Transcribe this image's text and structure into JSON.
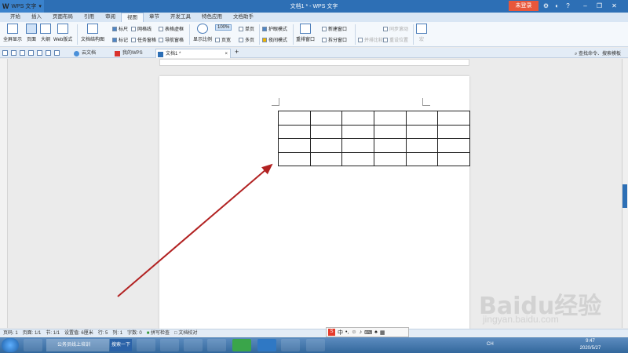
{
  "titlebar": {
    "app_name": "WPS 文字",
    "doc_title": "文档1 * - WPS 文字",
    "login": "未登录"
  },
  "tabs": [
    "开始",
    "插入",
    "页面布局",
    "引用",
    "审阅",
    "视图",
    "章节",
    "开发工具",
    "特色应用",
    "文档助手"
  ],
  "ribbon": {
    "fullscreen": "全屏显示",
    "page": "页面",
    "outline": "大纲",
    "web": "Web版式",
    "doc_structure": "文档结构图",
    "ruler": "标尺",
    "gridlines": "网格线",
    "table_dashed": "表格虚框",
    "marks": "标记",
    "task_pane": "任务窗格",
    "nav_pane": "导航窗格",
    "zoom": "显示比例",
    "zoom_value": "100%",
    "page_width": "页宽",
    "single_page": "单页",
    "multi_page": "多页",
    "eye_mode": "护眼模式",
    "night_mode": "夜间模式",
    "rearrange": "重排窗口",
    "new_window": "新建窗口",
    "split_window": "拆分窗口",
    "side_by_side": "并排比较",
    "sync_scroll": "同步滚动",
    "reset_pos": "重设位置",
    "macro": "宏"
  },
  "doc_tabs": [
    "云文档",
    "我的WPS",
    "文档1 *"
  ],
  "search_cmd": "查找命令、搜索模板",
  "document": {
    "table_rows": 4,
    "table_cols": 6
  },
  "status": {
    "page_num": "页码: 1",
    "pages": "页面: 1/1",
    "section": "节: 1/1",
    "settings": "设置值: 6厘米",
    "row": "行: 5",
    "col": "列: 1",
    "words": "字数: 0",
    "spell": "拼写检查",
    "doc_check": "文档校对"
  },
  "ime": {
    "mode": "中"
  },
  "taskbar": {
    "browser_label": "公务员线上培训",
    "search_btn": "搜索一下",
    "lang": "CH",
    "time": "9:47",
    "date": "2020/5/27"
  },
  "watermark": {
    "brand": "Baidu经验",
    "url": "jingyan.baidu.com"
  },
  "colors": {
    "titlebar": "#2d6fb5",
    "login": "#e8573b",
    "arrow": "#b22222"
  }
}
